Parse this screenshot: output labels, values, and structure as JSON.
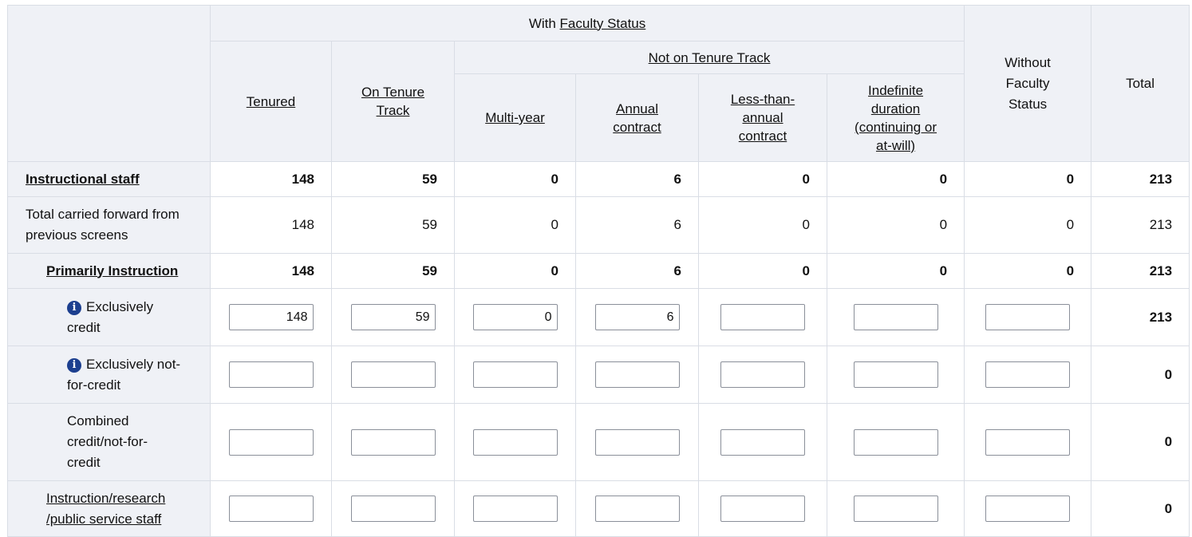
{
  "header": {
    "with_prefix": "With",
    "faculty_status": "Faculty Status",
    "not_on_tenure_track": "Not on Tenure Track",
    "without_faculty_status": "Without Faculty Status",
    "total": "Total",
    "tenured": "Tenured",
    "on_tenure_track": "On Tenure Track",
    "multi_year": "Multi-year",
    "annual_contract": "Annual contract",
    "less_than_annual": "Less-than-annual contract",
    "indefinite": "Indefinite duration (continuing or at-will)"
  },
  "rows": {
    "instructional_staff": {
      "label": "Instructional staff",
      "values": [
        "148",
        "59",
        "0",
        "6",
        "0",
        "0",
        "0",
        "213"
      ]
    },
    "carried_forward": {
      "label": "Total carried forward from previous screens",
      "values": [
        "148",
        "59",
        "0",
        "6",
        "0",
        "0",
        "0",
        "213"
      ]
    },
    "primarily_instruction": {
      "label": "Primarily Instruction",
      "values": [
        "148",
        "59",
        "0",
        "6",
        "0",
        "0",
        "0",
        "213"
      ]
    },
    "exclusively_credit": {
      "label": "Exclusively credit",
      "inputs": [
        "148",
        "59",
        "0",
        "6",
        "",
        "",
        ""
      ],
      "total": "213"
    },
    "exclusively_not_for_credit": {
      "label": "Exclusively not-for-credit",
      "inputs": [
        "",
        "",
        "",
        "",
        "",
        "",
        ""
      ],
      "total": "0"
    },
    "combined": {
      "label": "Combined credit/not-for-credit",
      "inputs": [
        "",
        "",
        "",
        "",
        "",
        "",
        ""
      ],
      "total": "0"
    },
    "instruction_research": {
      "label": "Instruction/research /public service staff",
      "inputs": [
        "",
        "",
        "",
        "",
        "",
        "",
        ""
      ],
      "total": "0"
    }
  },
  "icons": {
    "info": "info-icon"
  },
  "colors": {
    "header_bg": "#eff1f6",
    "border": "#d9dde5",
    "info_icon": "#1c3f8f"
  }
}
